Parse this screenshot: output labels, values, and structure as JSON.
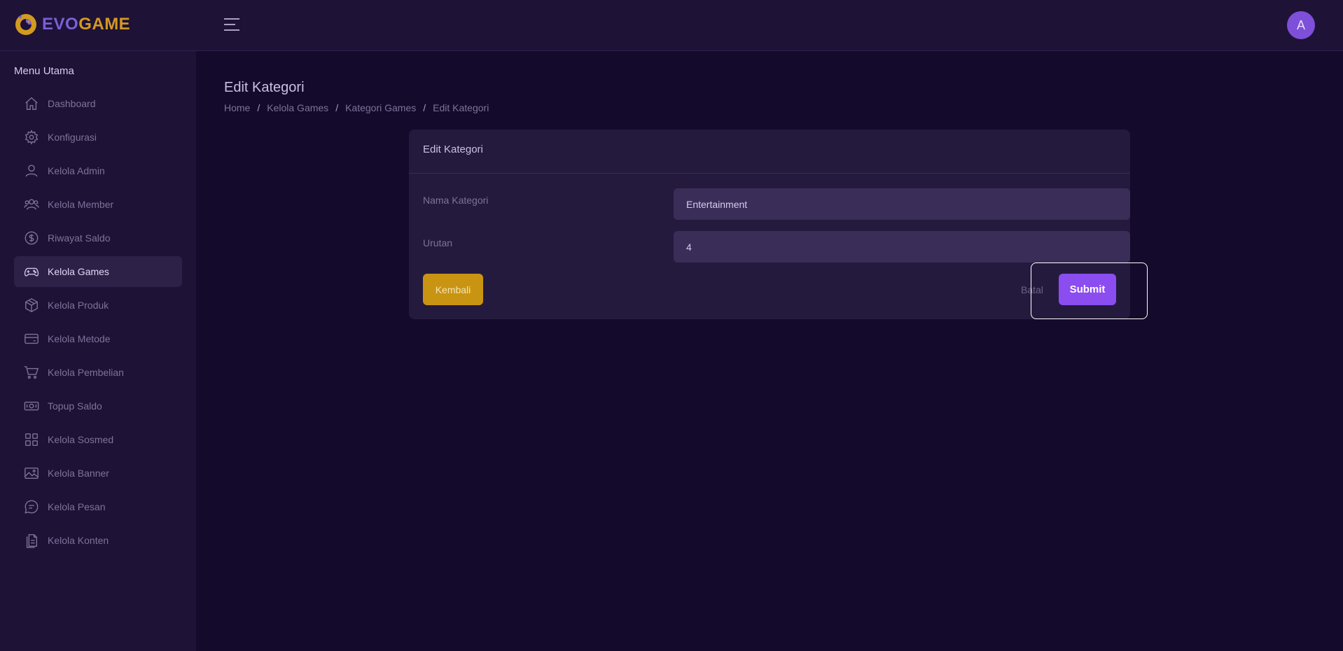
{
  "brand": {
    "name_part1": "EVO",
    "name_part2": "GAME",
    "logo_icon": "dragon-logo-icon"
  },
  "header": {
    "menu_icon": "hamburger-icon",
    "avatar_initial": "A"
  },
  "sidebar": {
    "title": "Menu Utama",
    "items": [
      {
        "label": "Dashboard",
        "icon": "home-icon"
      },
      {
        "label": "Konfigurasi",
        "icon": "gear-icon"
      },
      {
        "label": "Kelola Admin",
        "icon": "user-icon"
      },
      {
        "label": "Kelola Member",
        "icon": "users-icon"
      },
      {
        "label": "Riwayat Saldo",
        "icon": "dollar-circle-icon"
      },
      {
        "label": "Kelola Games",
        "icon": "gamepad-icon",
        "active": true
      },
      {
        "label": "Kelola Produk",
        "icon": "box-icon"
      },
      {
        "label": "Kelola Metode",
        "icon": "credit-card-icon"
      },
      {
        "label": "Kelola Pembelian",
        "icon": "cart-icon"
      },
      {
        "label": "Topup Saldo",
        "icon": "money-icon"
      },
      {
        "label": "Kelola Sosmed",
        "icon": "grid-icon"
      },
      {
        "label": "Kelola Banner",
        "icon": "image-icon"
      },
      {
        "label": "Kelola Pesan",
        "icon": "chat-icon"
      },
      {
        "label": "Kelola Konten",
        "icon": "document-icon"
      }
    ]
  },
  "page": {
    "title": "Edit Kategori",
    "breadcrumb": [
      "Home",
      "Kelola Games",
      "Kategori Games",
      "Edit Kategori"
    ],
    "breadcrumb_separator": "/"
  },
  "form": {
    "card_title": "Edit Kategori",
    "fields": [
      {
        "label": "Nama Kategori",
        "value": "Entertainment"
      },
      {
        "label": "Urutan",
        "value": "4"
      }
    ],
    "back_label": "Kembali",
    "cancel_label": "Batal",
    "submit_label": "Submit"
  },
  "colors": {
    "background": "#140a2b",
    "panel": "#1e1237",
    "card": "#241a3e",
    "accent": "#8b4cf0",
    "warning": "#c99412",
    "brand_purple": "#7b5fd6",
    "brand_gold": "#d49a1f"
  }
}
